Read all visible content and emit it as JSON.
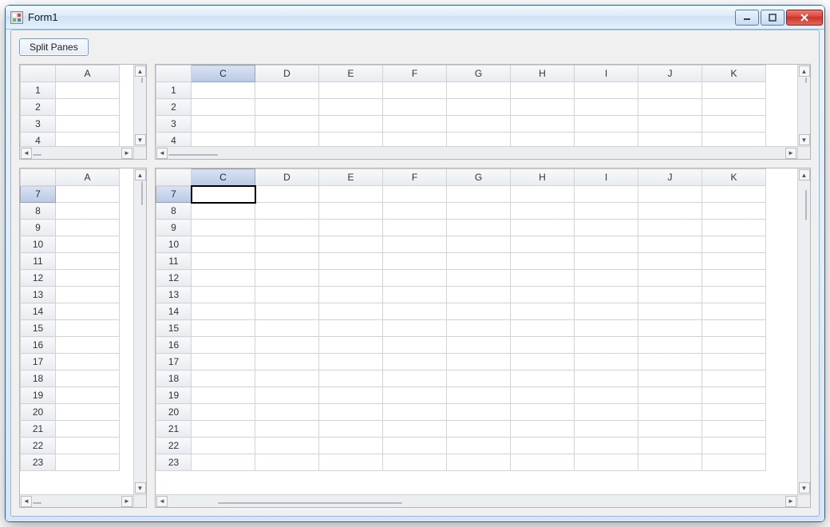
{
  "window": {
    "title": "Form1"
  },
  "toolbar": {
    "split_label": "Split Panes"
  },
  "panes": {
    "top_left": {
      "columns": [
        "A"
      ],
      "rows": [
        "1",
        "2",
        "3",
        "4"
      ],
      "selected_col": null,
      "selected_row": null,
      "hscroll_thumb_pct": [
        0,
        10
      ],
      "vscroll_thumb_pct": [
        0,
        10
      ]
    },
    "top_right": {
      "columns": [
        "C",
        "D",
        "E",
        "F",
        "G",
        "H",
        "I",
        "J",
        "K"
      ],
      "rows": [
        "1",
        "2",
        "3",
        "4"
      ],
      "selected_col": "C",
      "selected_row": null,
      "hscroll_thumb_pct": [
        0,
        8
      ],
      "vscroll_thumb_pct": [
        0,
        10
      ]
    },
    "bottom_left": {
      "columns": [
        "A"
      ],
      "rows": [
        "7",
        "8",
        "9",
        "10",
        "11",
        "12",
        "13",
        "14",
        "15",
        "16",
        "17",
        "18",
        "19",
        "20",
        "21",
        "22",
        "23"
      ],
      "selected_col": null,
      "selected_row": "7",
      "hscroll_thumb_pct": [
        0,
        10
      ],
      "vscroll_thumb_pct": [
        0,
        8
      ]
    },
    "bottom_right": {
      "columns": [
        "C",
        "D",
        "E",
        "F",
        "G",
        "H",
        "I",
        "J",
        "K"
      ],
      "rows": [
        "7",
        "8",
        "9",
        "10",
        "11",
        "12",
        "13",
        "14",
        "15",
        "16",
        "17",
        "18",
        "19",
        "20",
        "21",
        "22",
        "23"
      ],
      "selected_col": "C",
      "selected_row": "7",
      "selected_cell": {
        "row": "7",
        "col": "C"
      },
      "hscroll_thumb_pct": [
        8,
        30
      ],
      "vscroll_thumb_pct": [
        3,
        10
      ]
    }
  }
}
